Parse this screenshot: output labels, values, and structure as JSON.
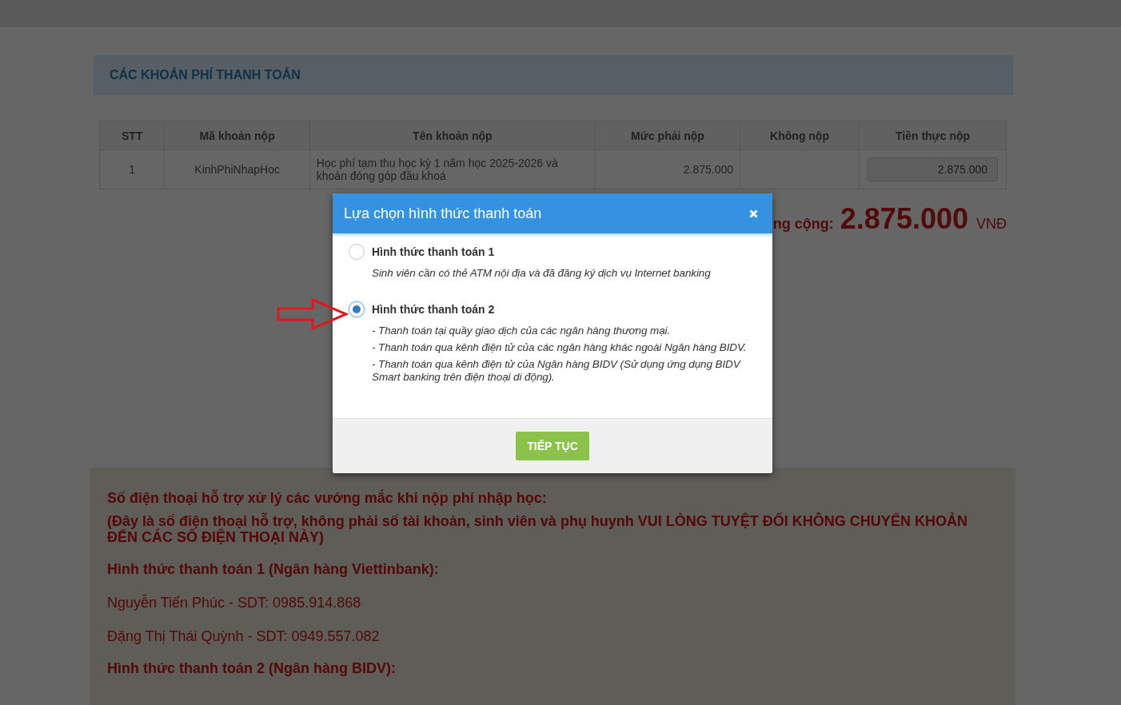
{
  "section_title": "CÁC KHOẢN PHÍ THANH TOÁN",
  "table": {
    "columns": [
      "STT",
      "Mã khoản nộp",
      "Tên khoản nộp",
      "Mức phải nộp",
      "Không nộp",
      "Tiền thực nộp"
    ],
    "rows": [
      {
        "stt": "1",
        "code": "KinhPhiNhapHoc",
        "name": "Học phí tạm thu học kỳ 1 năm học 2025-2026 và khoản đóng góp đầu khoá",
        "amount": "2.875.000",
        "paid": "2.875.000"
      }
    ]
  },
  "total": {
    "label": "ng cộng:",
    "value": "2.875.000",
    "unit": "VNĐ"
  },
  "support": {
    "heading": "Số điện thoại hỗ trợ xử lý các vướng mắc khi nộp phí nhập học:",
    "warning": "(Đây là số điện thoại hỗ trợ, không phải số tài khoản, sinh viên và phụ huynh VUI LÒNG TUYỆT ĐỐI KHÔNG CHUYỂN KHOẢN ĐẾN CÁC SỐ ĐIỆN THOẠI NÀY)",
    "items": [
      {
        "kind": "heading",
        "text": "Hình thức thanh toán 1 (Ngân hàng Viettinbank):"
      },
      {
        "kind": "contact",
        "text": "Nguyễn Tiến Phúc - SDT: 0985.914.868"
      },
      {
        "kind": "contact",
        "text": "Đặng Thị Thái Quỳnh - SDT: 0949.557.082"
      },
      {
        "kind": "heading",
        "text": "Hình thức thanh toán 2  (Ngân hàng BIDV):"
      }
    ]
  },
  "modal": {
    "title": "Lựa chọn hình thức thanh toán",
    "options": [
      {
        "label": "Hình thức thanh toán 1",
        "selected": false,
        "lines": [
          "Sinh viên cần có thẻ ATM nội địa và đã đăng ký dịch vụ Internet banking"
        ]
      },
      {
        "label": "Hình thức thanh toán 2",
        "selected": true,
        "lines": [
          "- Thanh toán tại quầy giao dịch của các ngân hàng thương mại.",
          "- Thanh toán qua kênh điện tử của các ngân hàng khác ngoài Ngân hàng BIDV.",
          "- Thanh toán qua kênh điện tử của Ngân hàng BIDV (Sử dụng ứng dụng BIDV Smart banking trên điện thoại di động)."
        ]
      }
    ],
    "button": "TIẾP TỤC"
  }
}
